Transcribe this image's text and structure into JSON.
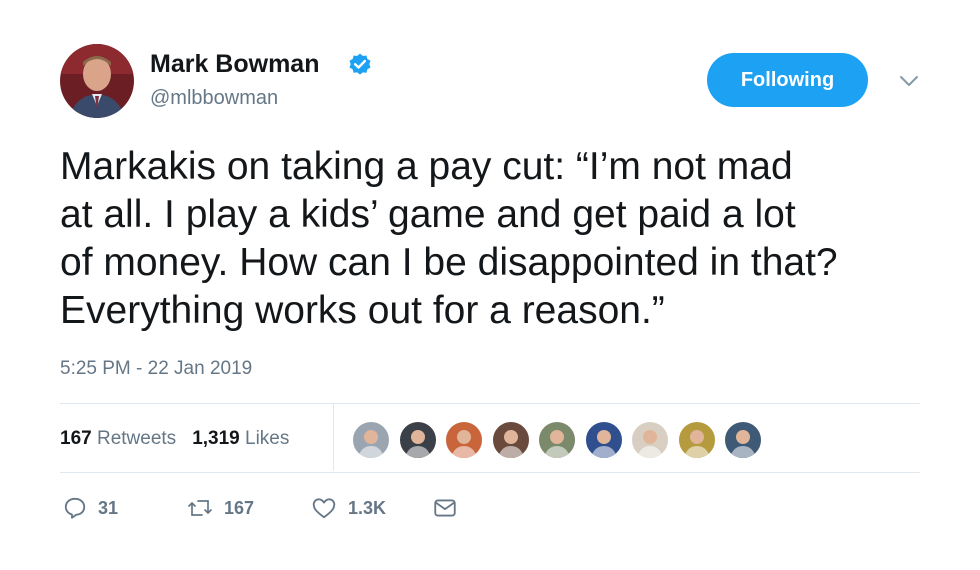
{
  "author": {
    "name": "Mark Bowman",
    "handle": "@mlbbowman",
    "verified": true,
    "avatar_icon": "user-avatar-photo"
  },
  "follow_button": {
    "label": "Following",
    "color": "#1da1f2"
  },
  "menu_icon": "chevron-down-icon",
  "tweet": {
    "lines": [
      "Markakis on taking a pay cut: “I’m not mad",
      "at all. I play a kids’ game and get paid a lot",
      "of money. How can I be disappointed in that?",
      "Everything works out for a reason.”"
    ]
  },
  "timestamp": "5:25 PM - 22 Jan 2019",
  "stats": {
    "retweets_count": "167",
    "retweets_label": "Retweets",
    "likes_count": "1,319",
    "likes_label": "Likes"
  },
  "liker_faces": [
    {
      "name": "liker-avatar-1",
      "bg": "#9aa5b1"
    },
    {
      "name": "liker-avatar-2",
      "bg": "#3b3f47"
    },
    {
      "name": "liker-avatar-3",
      "bg": "#c9653a"
    },
    {
      "name": "liker-avatar-4",
      "bg": "#6a4a3c"
    },
    {
      "name": "liker-avatar-5",
      "bg": "#7b8a6b"
    },
    {
      "name": "liker-avatar-6",
      "bg": "#2f4f8f"
    },
    {
      "name": "liker-avatar-7",
      "bg": "#d8cfc2"
    },
    {
      "name": "liker-avatar-8",
      "bg": "#b59a3e"
    },
    {
      "name": "liker-avatar-9",
      "bg": "#3f5a77"
    }
  ],
  "actions": {
    "reply_count": "31",
    "retweet_count": "167",
    "like_count": "1.3K"
  },
  "colors": {
    "text": "#14171a",
    "secondary": "#657786",
    "divider": "#e1e8ed",
    "accent": "#1da1f2"
  }
}
